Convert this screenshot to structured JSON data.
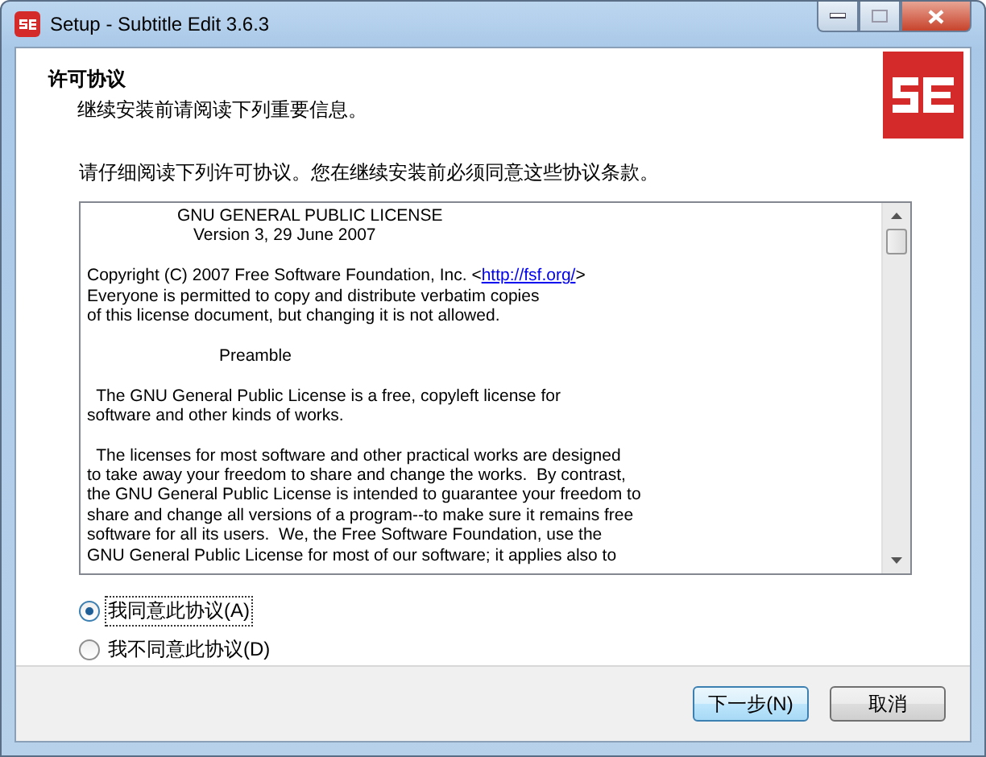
{
  "window": {
    "title": "Setup - Subtitle Edit 3.6.3"
  },
  "header": {
    "title": "许可协议",
    "subtitle": "继续安装前请阅读下列重要信息。"
  },
  "instruction": "请仔细阅读下列许可协议。您在继续安装前必须同意这些协议条款。",
  "license": {
    "paragraphs": [
      {
        "kind": "heading",
        "lines": [
          "GNU GENERAL PUBLIC LICENSE",
          "Version 3, 29 June 2007"
        ]
      },
      {
        "kind": "body",
        "lines": [
          {
            "text": "Copyright (C) 2007 Free Software Foundation, Inc. <",
            "link": "http://fsf.org/",
            "after": ">"
          },
          "Everyone is permitted to copy and distribute verbatim copies",
          "of this license document, but changing it is not allowed."
        ]
      },
      {
        "kind": "centered",
        "lines": [
          "Preamble"
        ]
      },
      {
        "kind": "body",
        "lines": [
          "  The GNU General Public License is a free, copyleft license for",
          "software and other kinds of works."
        ]
      },
      {
        "kind": "body",
        "lines": [
          "  The licenses for most software and other practical works are designed",
          "to take away your freedom to share and change the works.  By contrast,",
          "the GNU General Public License is intended to guarantee your freedom to",
          "share and change all versions of a program--to make sure it remains free",
          "software for all its users.  We, the Free Software Foundation, use the",
          "GNU General Public License for most of our software; it applies also to"
        ]
      }
    ]
  },
  "options": [
    {
      "label": "我同意此协议(A)",
      "selected": true
    },
    {
      "label": "我不同意此协议(D)",
      "selected": false
    }
  ],
  "buttons": [
    {
      "label": "下一步(N)",
      "kind": "default"
    },
    {
      "label": "取消",
      "kind": "normal"
    }
  ]
}
